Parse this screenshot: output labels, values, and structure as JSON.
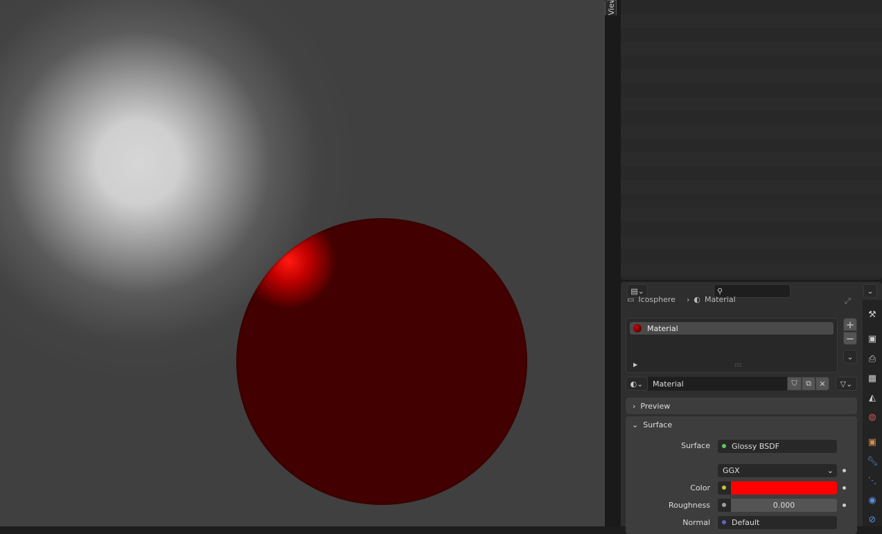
{
  "viewport": {
    "sidebar_tab": "View"
  },
  "properties": {
    "breadcrumb": {
      "object": "Icosphere",
      "material": "Material"
    },
    "material_slots": [
      {
        "name": "Material"
      }
    ],
    "material_name": "Material",
    "panels": {
      "preview": "Preview",
      "surface": "Surface"
    },
    "surface": {
      "surface_label": "Surface",
      "surface_value": "Glossy BSDF",
      "distribution": "GGX",
      "color_label": "Color",
      "color_value": "#ff0000",
      "roughness_label": "Roughness",
      "roughness_value": "0.000",
      "normal_label": "Normal",
      "normal_value": "Default"
    }
  },
  "colors": {
    "socket_shader": "#63c763",
    "socket_color": "#c7c729",
    "socket_float": "#a1a1a1",
    "socket_vector": "#6363c7"
  }
}
